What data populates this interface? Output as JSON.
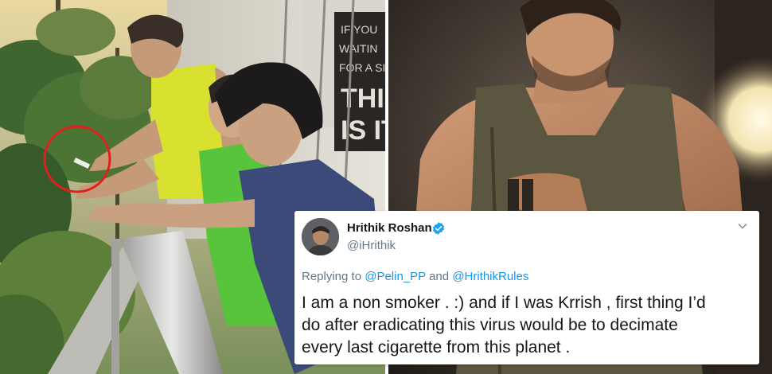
{
  "left_photo": {
    "sign_text": [
      "IF YOU",
      "WAITIN",
      "FOR A SI",
      "THIS",
      "IS IT"
    ]
  },
  "tweet": {
    "display_name": "Hrithik Roshan",
    "handle": "@iHrithik",
    "replying_prefix": "Replying to",
    "mention_1": "@Pelin_PP",
    "conjunction": "and",
    "mention_2": "@HrithikRules",
    "text_lines": [
      "I am a non smoker . :) and if I was Krrish , first thing I’d",
      "do after eradicating this virus would be to decimate",
      "every last cigarette from this planet ."
    ],
    "verified_color": "#1da1f2",
    "link_color": "#1b95e0",
    "icons": [
      "avatar",
      "verified-badge-icon",
      "chevron-down-icon"
    ]
  },
  "colors": {
    "circle_highlight": "#e0201c",
    "singlet_yellow": "#d8e030",
    "shirt_green": "#58c43c"
  }
}
